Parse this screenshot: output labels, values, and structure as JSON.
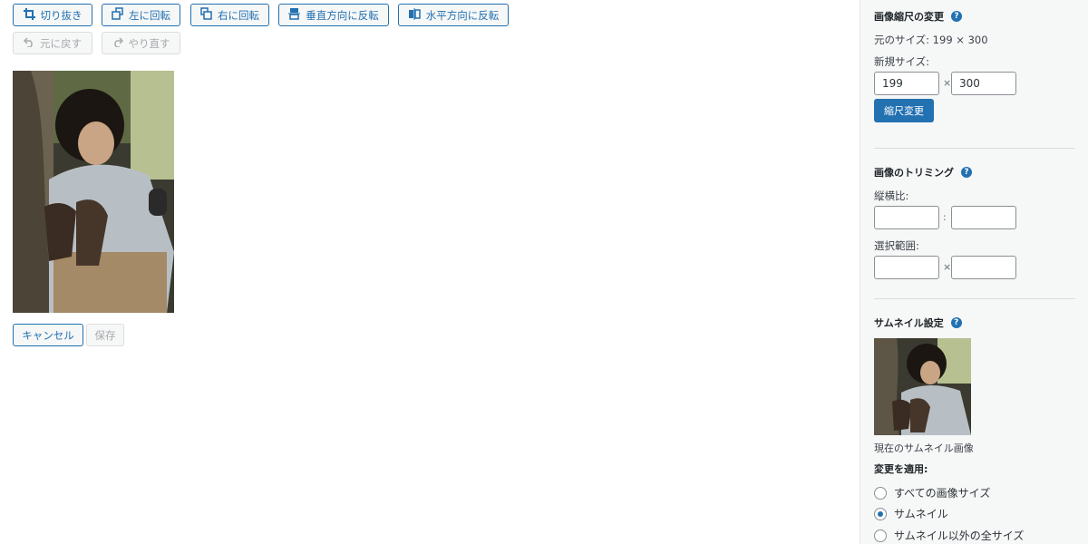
{
  "toolbar": {
    "crop": "切り抜き",
    "rotate_left": "左に回転",
    "rotate_right": "右に回転",
    "flip_vertical": "垂直方向に反転",
    "flip_horizontal": "水平方向に反転",
    "undo": "元に戻す",
    "redo": "やり直す"
  },
  "actions": {
    "cancel": "キャンセル",
    "save": "保存"
  },
  "sidebar": {
    "scale": {
      "title": "画像縮尺の変更",
      "original_size": "元のサイズ: 199 × 300",
      "new_size_label": "新規サイズ:",
      "width": "199",
      "height": "300",
      "sep": "×",
      "button": "縮尺変更"
    },
    "crop": {
      "title": "画像のトリミング",
      "ratio_label": "縦横比:",
      "ratio_sep": ":",
      "selection_label": "選択範囲:",
      "selection_sep": "×"
    },
    "thumbnail": {
      "title": "サムネイル設定",
      "caption": "現在のサムネイル画像",
      "apply_label": "変更を適用:",
      "options": [
        "すべての画像サイズ",
        "サムネイル",
        "サムネイル以外の全サイズ"
      ],
      "selected_index": 1
    },
    "help_glyph": "?"
  }
}
